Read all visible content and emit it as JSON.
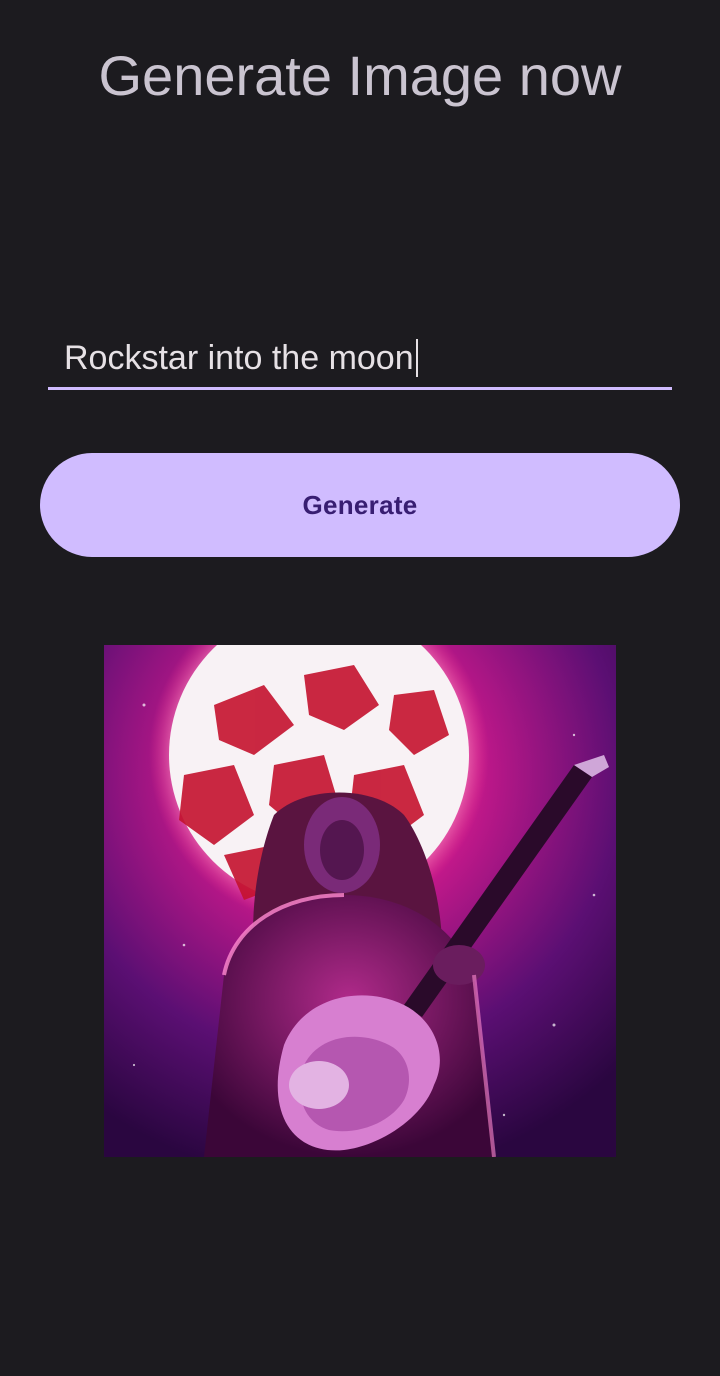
{
  "header": {
    "title": "Generate Image now"
  },
  "prompt_field": {
    "value": "Rockstar into the moon"
  },
  "generate_button": {
    "label": "Generate"
  },
  "result_image": {
    "icon": "generated-image",
    "description_colors": {
      "background": "#5a0f6e",
      "moon": "#ff5a8a",
      "accent": "#d0bcff"
    }
  },
  "colors": {
    "background": "#1c1b1f",
    "title_text": "#cac4d0",
    "button_fill": "#d0bcff",
    "button_text": "#381e72",
    "field_underline": "#d0bcff"
  }
}
